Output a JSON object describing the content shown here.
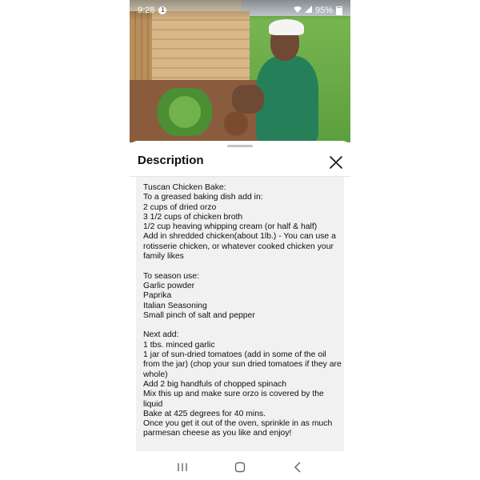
{
  "status_bar": {
    "time": "9:28",
    "notification_badge": "1",
    "battery": "95%"
  },
  "video": {
    "icons": [
      "person-in-garden",
      "notification-icon"
    ]
  },
  "sheet": {
    "title": "Description",
    "close_icon": "close-icon"
  },
  "description": {
    "lines": [
      "Tuscan Chicken Bake:",
      "To a greased baking dish add in:",
      "2 cups of dried orzo",
      "3 1/2 cups of chicken broth",
      "1/2 cup heaving whipping cream (or half & half)",
      "Add in shredded chicken(about 1lb.) - You can use a",
      "rotisserie chicken, or whatever cooked chicken your",
      "family likes",
      "",
      "To season use:",
      "Garlic powder",
      "Paprika",
      "Italian Seasoning",
      "Small pinch of salt and pepper",
      "",
      "Next add:",
      "1 tbs. minced garlic",
      "1 jar of sun-dried tomatoes (add in some of the oil",
      "from the jar) (chop your sun dried tomatoes if they are",
      "whole)",
      "Add 2 big handfuls of chopped spinach",
      "Mix this up and make sure orzo is covered by the",
      "liquid",
      "Bake at 425 degrees for 40 mins.",
      "Once you get it out of the oven, sprinkle in as much",
      "parmesan cheese as you like and enjoy!"
    ]
  },
  "nav": {
    "recents_icon": "recents-icon",
    "home_icon": "home-icon",
    "back_icon": "back-icon"
  }
}
